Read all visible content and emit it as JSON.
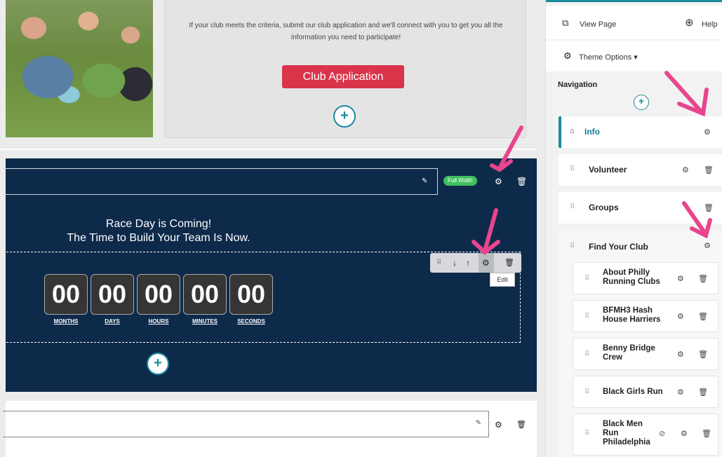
{
  "editor": {
    "top_text": "If your club meets the criteria, submit our club application and we'll connect with you to get you all the information you need to participate!",
    "club_button": "Club Application",
    "full_width_badge": "Full Width",
    "headline_line1": "Race Day is Coming!",
    "headline_line2": "The Time to Build Your Team Is Now.",
    "tooltip": "Edit",
    "countdown": [
      {
        "value": "00",
        "label": "MONTHS"
      },
      {
        "value": "00",
        "label": "DAYS"
      },
      {
        "value": "00",
        "label": "HOURS"
      },
      {
        "value": "00",
        "label": "MINUTES"
      },
      {
        "value": "00",
        "label": "SECONDS"
      }
    ]
  },
  "panel": {
    "view_page": "View Page",
    "help": "Help",
    "theme_options": "Theme Options ▾",
    "navigation_heading": "Navigation",
    "nav_items": [
      {
        "label": "Info"
      },
      {
        "label": "Volunteer"
      },
      {
        "label": "Groups"
      },
      {
        "label": "Find Your Club"
      }
    ],
    "sub_items": [
      {
        "label": "About Philly Running Clubs"
      },
      {
        "label": "BFMH3 Hash House Harriers"
      },
      {
        "label": "Benny Bridge Crew"
      },
      {
        "label": "Black Girls Run"
      },
      {
        "label": "Black Men Run Philadelphia"
      }
    ]
  },
  "colors": {
    "accent": "#1a8a9a",
    "navy": "#0e2a4a",
    "button_red": "#d9344a",
    "badge_green": "#3fbf5f",
    "annotation_pink": "#e8458e"
  },
  "icons": [
    "external-link-icon",
    "help-lifebuoy-icon",
    "gear-icon",
    "home-icon",
    "trash-icon",
    "drag-grip-icon",
    "edit-pencil-icon",
    "arrow-down-icon",
    "arrow-up-icon",
    "plus-icon",
    "eye-slash-icon"
  ]
}
